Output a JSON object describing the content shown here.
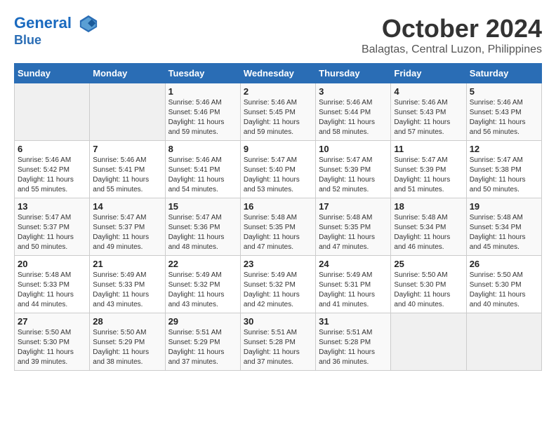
{
  "header": {
    "logo_line1": "General",
    "logo_line2": "Blue",
    "month": "October 2024",
    "location": "Balagtas, Central Luzon, Philippines"
  },
  "columns": [
    "Sunday",
    "Monday",
    "Tuesday",
    "Wednesday",
    "Thursday",
    "Friday",
    "Saturday"
  ],
  "weeks": [
    [
      {
        "num": "",
        "info": ""
      },
      {
        "num": "",
        "info": ""
      },
      {
        "num": "1",
        "info": "Sunrise: 5:46 AM\nSunset: 5:46 PM\nDaylight: 11 hours and 59 minutes."
      },
      {
        "num": "2",
        "info": "Sunrise: 5:46 AM\nSunset: 5:45 PM\nDaylight: 11 hours and 59 minutes."
      },
      {
        "num": "3",
        "info": "Sunrise: 5:46 AM\nSunset: 5:44 PM\nDaylight: 11 hours and 58 minutes."
      },
      {
        "num": "4",
        "info": "Sunrise: 5:46 AM\nSunset: 5:43 PM\nDaylight: 11 hours and 57 minutes."
      },
      {
        "num": "5",
        "info": "Sunrise: 5:46 AM\nSunset: 5:43 PM\nDaylight: 11 hours and 56 minutes."
      }
    ],
    [
      {
        "num": "6",
        "info": "Sunrise: 5:46 AM\nSunset: 5:42 PM\nDaylight: 11 hours and 55 minutes."
      },
      {
        "num": "7",
        "info": "Sunrise: 5:46 AM\nSunset: 5:41 PM\nDaylight: 11 hours and 55 minutes."
      },
      {
        "num": "8",
        "info": "Sunrise: 5:46 AM\nSunset: 5:41 PM\nDaylight: 11 hours and 54 minutes."
      },
      {
        "num": "9",
        "info": "Sunrise: 5:47 AM\nSunset: 5:40 PM\nDaylight: 11 hours and 53 minutes."
      },
      {
        "num": "10",
        "info": "Sunrise: 5:47 AM\nSunset: 5:39 PM\nDaylight: 11 hours and 52 minutes."
      },
      {
        "num": "11",
        "info": "Sunrise: 5:47 AM\nSunset: 5:39 PM\nDaylight: 11 hours and 51 minutes."
      },
      {
        "num": "12",
        "info": "Sunrise: 5:47 AM\nSunset: 5:38 PM\nDaylight: 11 hours and 50 minutes."
      }
    ],
    [
      {
        "num": "13",
        "info": "Sunrise: 5:47 AM\nSunset: 5:37 PM\nDaylight: 11 hours and 50 minutes."
      },
      {
        "num": "14",
        "info": "Sunrise: 5:47 AM\nSunset: 5:37 PM\nDaylight: 11 hours and 49 minutes."
      },
      {
        "num": "15",
        "info": "Sunrise: 5:47 AM\nSunset: 5:36 PM\nDaylight: 11 hours and 48 minutes."
      },
      {
        "num": "16",
        "info": "Sunrise: 5:48 AM\nSunset: 5:35 PM\nDaylight: 11 hours and 47 minutes."
      },
      {
        "num": "17",
        "info": "Sunrise: 5:48 AM\nSunset: 5:35 PM\nDaylight: 11 hours and 47 minutes."
      },
      {
        "num": "18",
        "info": "Sunrise: 5:48 AM\nSunset: 5:34 PM\nDaylight: 11 hours and 46 minutes."
      },
      {
        "num": "19",
        "info": "Sunrise: 5:48 AM\nSunset: 5:34 PM\nDaylight: 11 hours and 45 minutes."
      }
    ],
    [
      {
        "num": "20",
        "info": "Sunrise: 5:48 AM\nSunset: 5:33 PM\nDaylight: 11 hours and 44 minutes."
      },
      {
        "num": "21",
        "info": "Sunrise: 5:49 AM\nSunset: 5:33 PM\nDaylight: 11 hours and 43 minutes."
      },
      {
        "num": "22",
        "info": "Sunrise: 5:49 AM\nSunset: 5:32 PM\nDaylight: 11 hours and 43 minutes."
      },
      {
        "num": "23",
        "info": "Sunrise: 5:49 AM\nSunset: 5:32 PM\nDaylight: 11 hours and 42 minutes."
      },
      {
        "num": "24",
        "info": "Sunrise: 5:49 AM\nSunset: 5:31 PM\nDaylight: 11 hours and 41 minutes."
      },
      {
        "num": "25",
        "info": "Sunrise: 5:50 AM\nSunset: 5:30 PM\nDaylight: 11 hours and 40 minutes."
      },
      {
        "num": "26",
        "info": "Sunrise: 5:50 AM\nSunset: 5:30 PM\nDaylight: 11 hours and 40 minutes."
      }
    ],
    [
      {
        "num": "27",
        "info": "Sunrise: 5:50 AM\nSunset: 5:30 PM\nDaylight: 11 hours and 39 minutes."
      },
      {
        "num": "28",
        "info": "Sunrise: 5:50 AM\nSunset: 5:29 PM\nDaylight: 11 hours and 38 minutes."
      },
      {
        "num": "29",
        "info": "Sunrise: 5:51 AM\nSunset: 5:29 PM\nDaylight: 11 hours and 37 minutes."
      },
      {
        "num": "30",
        "info": "Sunrise: 5:51 AM\nSunset: 5:28 PM\nDaylight: 11 hours and 37 minutes."
      },
      {
        "num": "31",
        "info": "Sunrise: 5:51 AM\nSunset: 5:28 PM\nDaylight: 11 hours and 36 minutes."
      },
      {
        "num": "",
        "info": ""
      },
      {
        "num": "",
        "info": ""
      }
    ]
  ]
}
